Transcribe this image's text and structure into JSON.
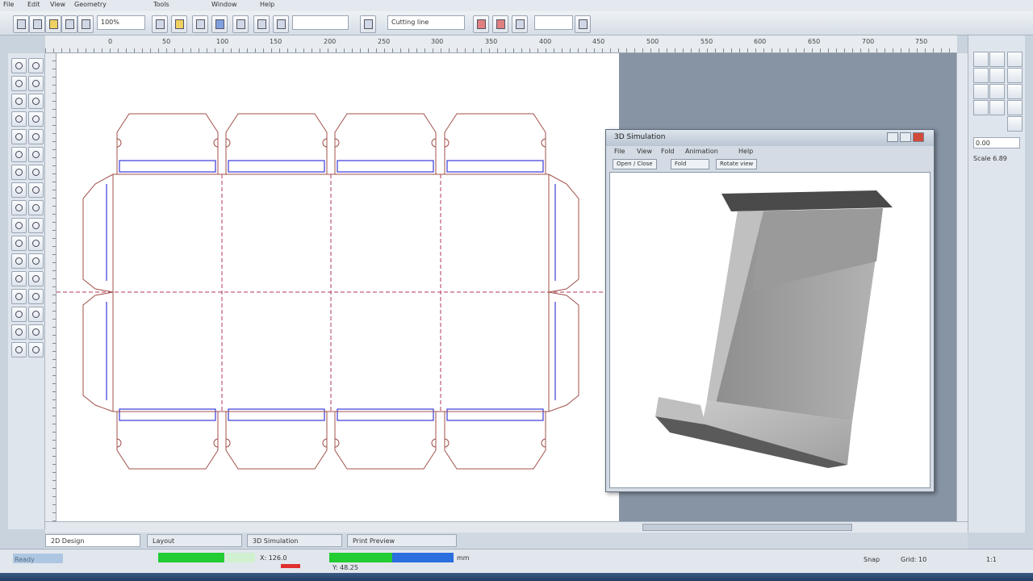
{
  "app": {
    "menu": [
      "File",
      "Edit",
      "View",
      "Geometry",
      "Tools",
      "Window",
      "Help"
    ]
  },
  "toolbar": {
    "field_zoom": "100%",
    "field_layer": "Cutting line"
  },
  "rulers": {
    "top_labels": [
      "0",
      "50",
      "100",
      "150",
      "200",
      "250",
      "300",
      "350",
      "400",
      "450",
      "500",
      "550",
      "600",
      "650",
      "700",
      "750"
    ]
  },
  "right_panel": {
    "field_value": "0.00",
    "readout": "Scale 6.89"
  },
  "bottom_tabs": [
    "2D Design",
    "Layout",
    "3D Simulation",
    "Print Preview"
  ],
  "status": {
    "left_text": "Ready",
    "coords": "X: 126.0",
    "coords2": "Y: 48.25",
    "units": "mm",
    "mode": "Snap",
    "grid": "Grid: 10",
    "zoom": "1:1"
  },
  "preview_window": {
    "title": "3D Simulation",
    "menu": [
      "File",
      "View",
      "Fold",
      "Animation",
      "Help"
    ],
    "tabs": [
      "Open / Close",
      "Fold",
      "Rotate view"
    ]
  },
  "colors": {
    "cut_line": "#a0504a",
    "crease_line": "#3a3adc",
    "perforation": "#b03a5a",
    "accent_green": "#22cc33",
    "accent_blue": "#2a6ee0"
  }
}
